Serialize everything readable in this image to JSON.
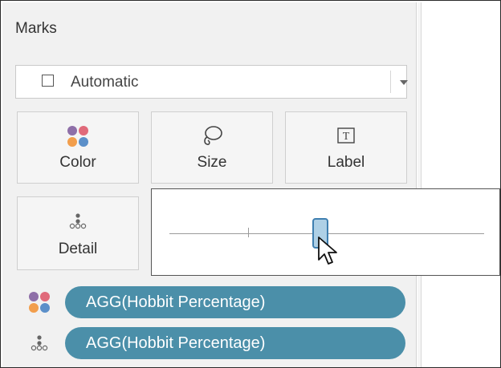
{
  "marks": {
    "title": "Marks",
    "mark_type": {
      "value": "Automatic"
    },
    "cards": [
      {
        "label": "Color",
        "icon": "color-dots-icon"
      },
      {
        "label": "Size",
        "icon": "size-lasso-icon"
      },
      {
        "label": "Label",
        "icon": "label-T-icon"
      },
      {
        "label": "Detail",
        "icon": "detail-dots-icon"
      }
    ],
    "size_slider": {
      "value": 0.48
    },
    "fields": [
      {
        "label": "AGG(Hobbit Percentage)",
        "encoding": "color",
        "icon": "color-dots-icon"
      },
      {
        "label": "AGG(Hobbit Percentage)",
        "encoding": "detail",
        "icon": "detail-dots-icon"
      }
    ]
  },
  "colors": {
    "pill": "#4b8fa9",
    "thumb_fill": "#aed0e6",
    "thumb_border": "#3f7fb0",
    "dot_purple": "#8e6fa8",
    "dot_pink": "#e06a7a",
    "dot_orange": "#f29e4c",
    "dot_blue": "#5b8fc9"
  }
}
